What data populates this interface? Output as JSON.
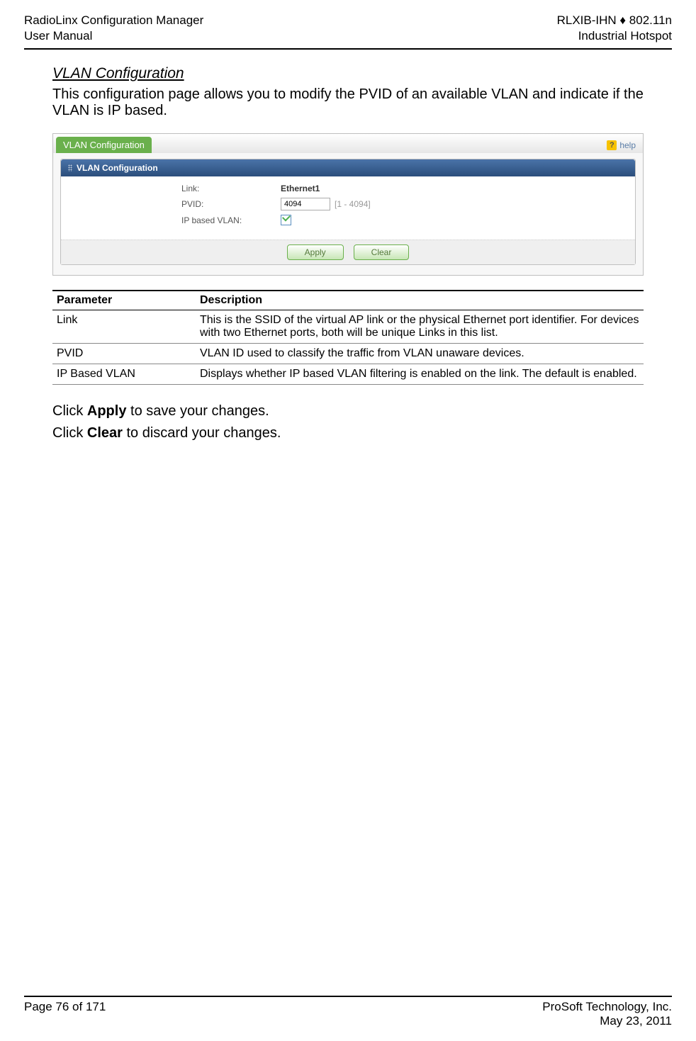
{
  "header": {
    "left_line1": "RadioLinx Configuration Manager",
    "left_line2": "User Manual",
    "right_line1": "RLXIB-IHN ♦ 802.11n",
    "right_line2": "Industrial Hotspot"
  },
  "title": "VLAN Configuration",
  "intro": "This configuration page allows you to modify the PVID of an available VLAN and indicate if the VLAN is IP based.",
  "shot": {
    "tab": "VLAN Configuration",
    "help": "help",
    "panel_title": "VLAN Configuration",
    "link_label": "Link:",
    "link_value": "Ethernet1",
    "pvid_label": "PVID:",
    "pvid_value": "4094",
    "pvid_hint": "[1 - 4094]",
    "ipvlan_label": "IP based VLAN:",
    "btn_apply": "Apply",
    "btn_clear": "Clear"
  },
  "table": {
    "h1": "Parameter",
    "h2": "Description",
    "rows": [
      {
        "p": "Link",
        "d": "This is the SSID of the virtual AP link or the physical Ethernet port identifier. For devices with two Ethernet ports, both will be unique Links in this list."
      },
      {
        "p": "PVID",
        "d": "VLAN ID used to classify the traffic from VLAN unaware devices."
      },
      {
        "p": "IP Based VLAN",
        "d": "Displays whether IP based VLAN filtering is enabled on the link. The default is enabled."
      }
    ]
  },
  "notes": {
    "apply_pre": "Click ",
    "apply_bold": "Apply",
    "apply_post": " to save your changes.",
    "clear_pre": "Click ",
    "clear_bold": "Clear",
    "clear_post": " to discard your changes."
  },
  "footer": {
    "left": "Page 76 of 171",
    "right_line1": "ProSoft Technology, Inc.",
    "right_line2": "May 23, 2011"
  }
}
